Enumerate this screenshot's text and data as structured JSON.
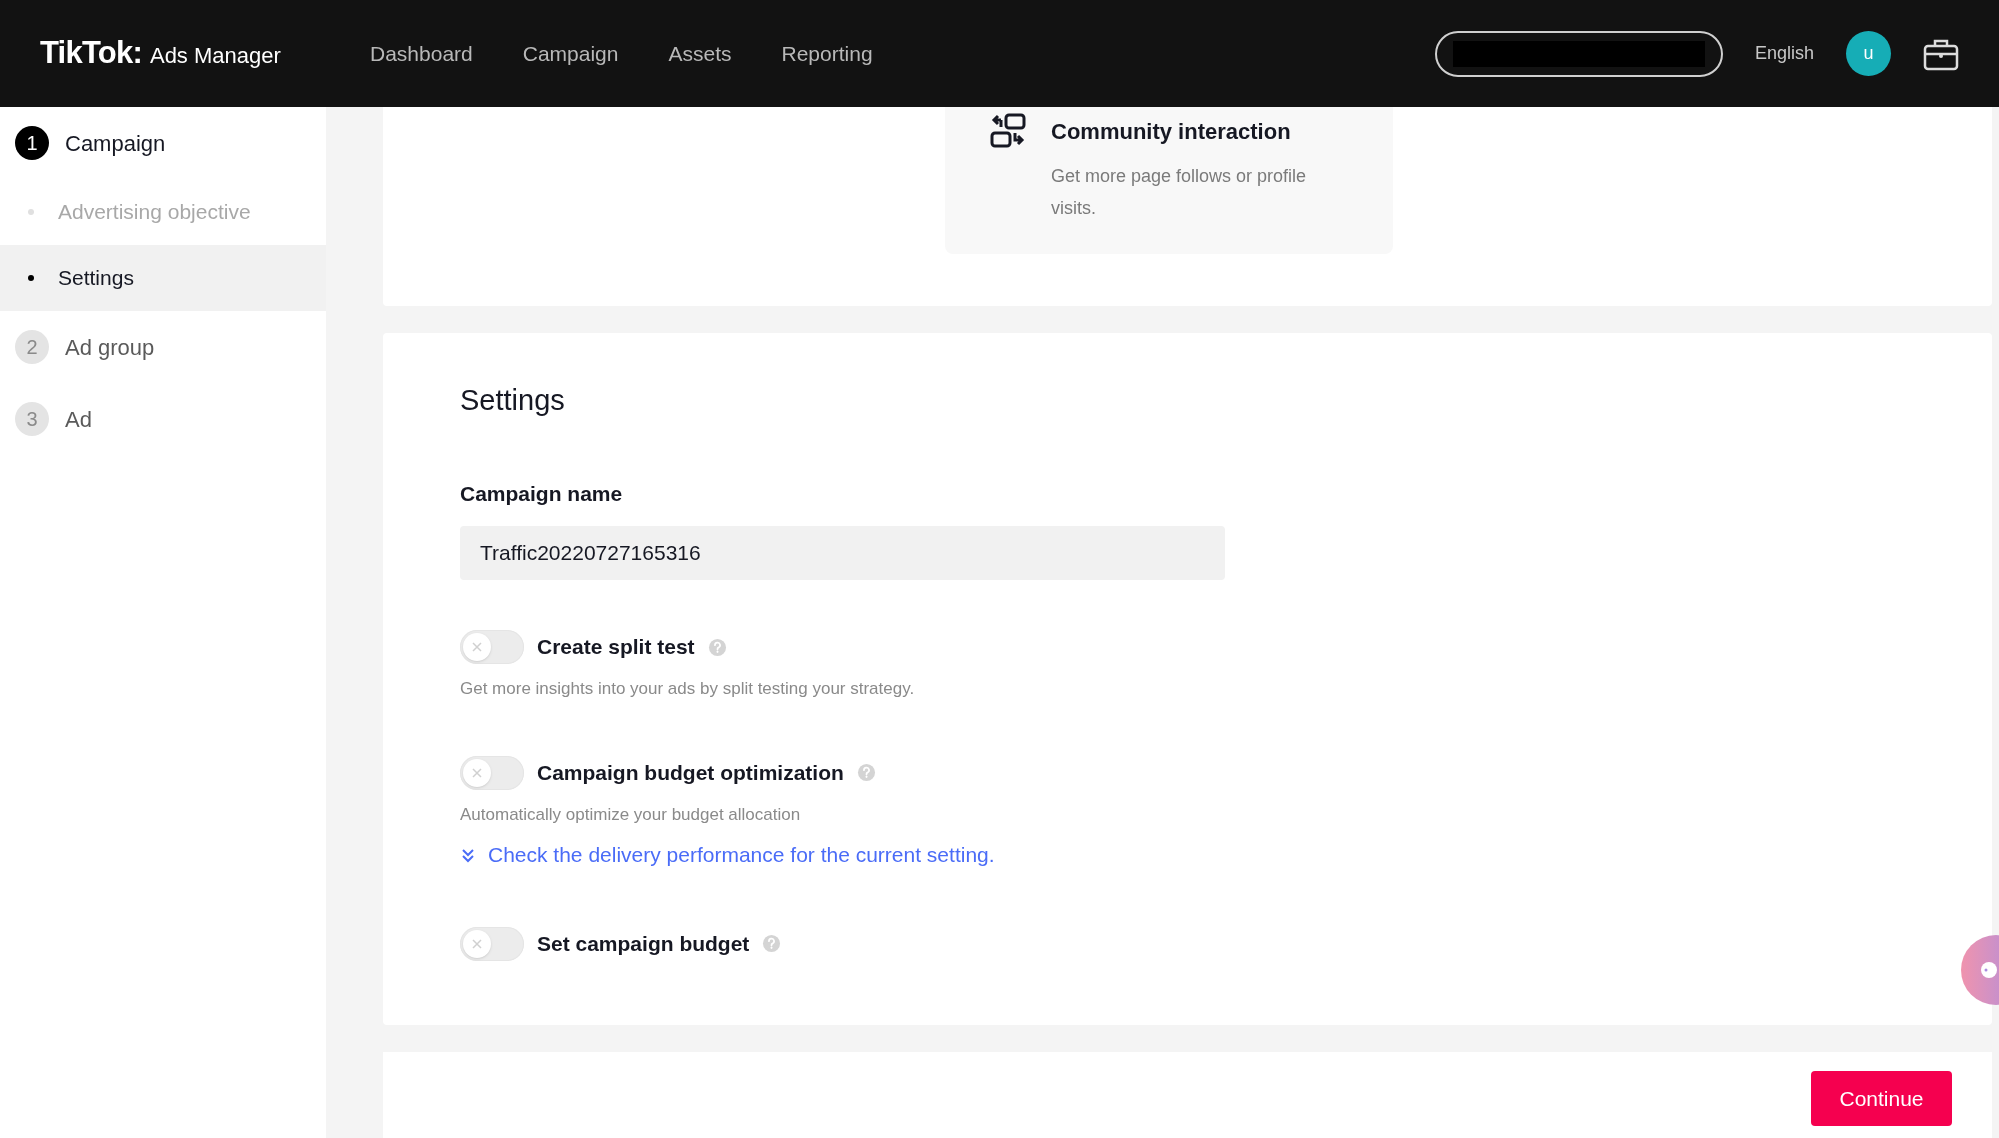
{
  "header": {
    "logo": "TikTok:",
    "product": "Ads Manager",
    "nav": [
      {
        "label": "Dashboard"
      },
      {
        "label": "Campaign"
      },
      {
        "label": "Assets"
      },
      {
        "label": "Reporting"
      }
    ],
    "language": "English",
    "avatar": "u"
  },
  "sidebar": {
    "steps": [
      {
        "number": "1",
        "label": "Campaign",
        "active": true,
        "children": [
          {
            "label": "Advertising objective",
            "selected": false
          },
          {
            "label": "Settings",
            "selected": true
          }
        ]
      },
      {
        "number": "2",
        "label": "Ad group",
        "active": false
      },
      {
        "number": "3",
        "label": "Ad",
        "active": false
      }
    ]
  },
  "objective_option": {
    "title": "Community interaction",
    "description": "Get more page follows or profile visits."
  },
  "settings": {
    "title": "Settings",
    "campaign_name": {
      "label": "Campaign name",
      "value": "Traffic20220727165316"
    },
    "toggles": [
      {
        "label": "Create split test",
        "on": false,
        "description": "Get more insights into your ads by split testing your strategy."
      },
      {
        "label": "Campaign budget optimization",
        "on": false,
        "description": "Automatically optimize your budget allocation",
        "link": "Check the delivery performance for the current setting."
      },
      {
        "label": "Set campaign budget",
        "on": false
      }
    ]
  },
  "footer": {
    "button": "Continue"
  }
}
